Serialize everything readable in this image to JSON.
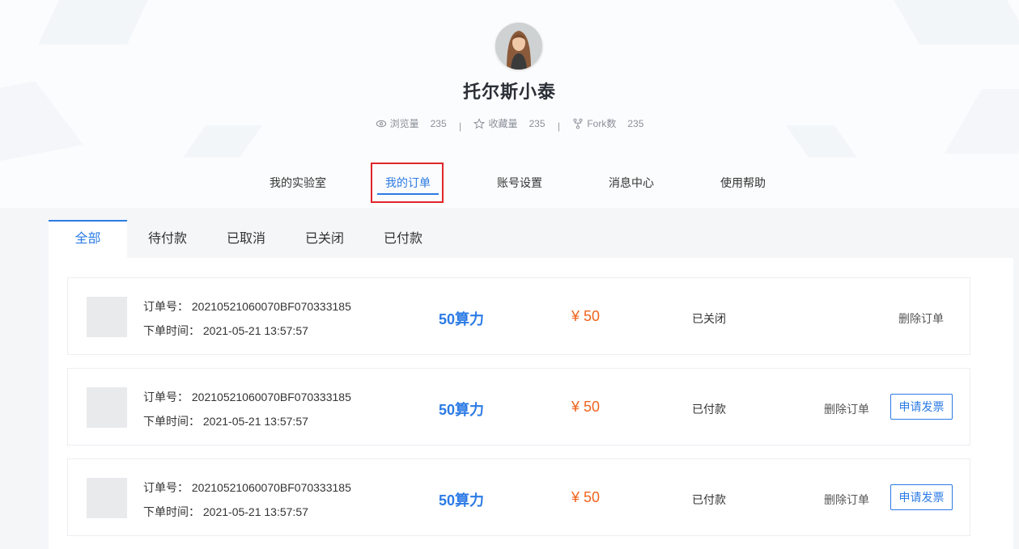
{
  "profile": {
    "username": "托尔斯小泰",
    "stats": [
      {
        "icon": "eye-icon",
        "label": "浏览量",
        "value": "235"
      },
      {
        "icon": "star-icon",
        "label": "收藏量",
        "value": "235"
      },
      {
        "icon": "fork-icon",
        "label": "Fork数",
        "value": "235"
      }
    ],
    "separator": "|"
  },
  "nav": {
    "items": [
      "我的实验室",
      "我的订单",
      "账号设置",
      "消息中心",
      "使用帮助"
    ],
    "active": "我的订单",
    "accent_color": "#2c7be5",
    "highlight_color": "#e0262a"
  },
  "tabs": {
    "items": [
      "全部",
      "待付款",
      "已取消",
      "已关闭",
      "已付款"
    ],
    "active": "全部"
  },
  "orders": [
    {
      "order_no_label": "订单号：",
      "order_no": "20210521060070BF070333185",
      "time_label": "下单时间：",
      "time": "2021-05-21 13:57:57",
      "product": "50算力",
      "price": "¥ 50",
      "status": "已关闭",
      "delete_label": "删除订单"
    },
    {
      "order_no_label": "订单号：",
      "order_no": "20210521060070BF070333185",
      "time_label": "下单时间：",
      "time": "2021-05-21 13:57:57",
      "product": "50算力",
      "price": "¥ 50",
      "status": "已付款",
      "delete_label": "删除订单",
      "invoice_label": "申请发票"
    },
    {
      "order_no_label": "订单号：",
      "order_no": "20210521060070BF070333185",
      "time_label": "下单时间：",
      "time": "2021-05-21 13:57:57",
      "product": "50算力",
      "price": "¥ 50",
      "status": "已付款",
      "delete_label": "删除订单",
      "invoice_label": "申请发票"
    }
  ],
  "colors": {
    "price": "#f0641e",
    "product": "#2c7be5"
  }
}
